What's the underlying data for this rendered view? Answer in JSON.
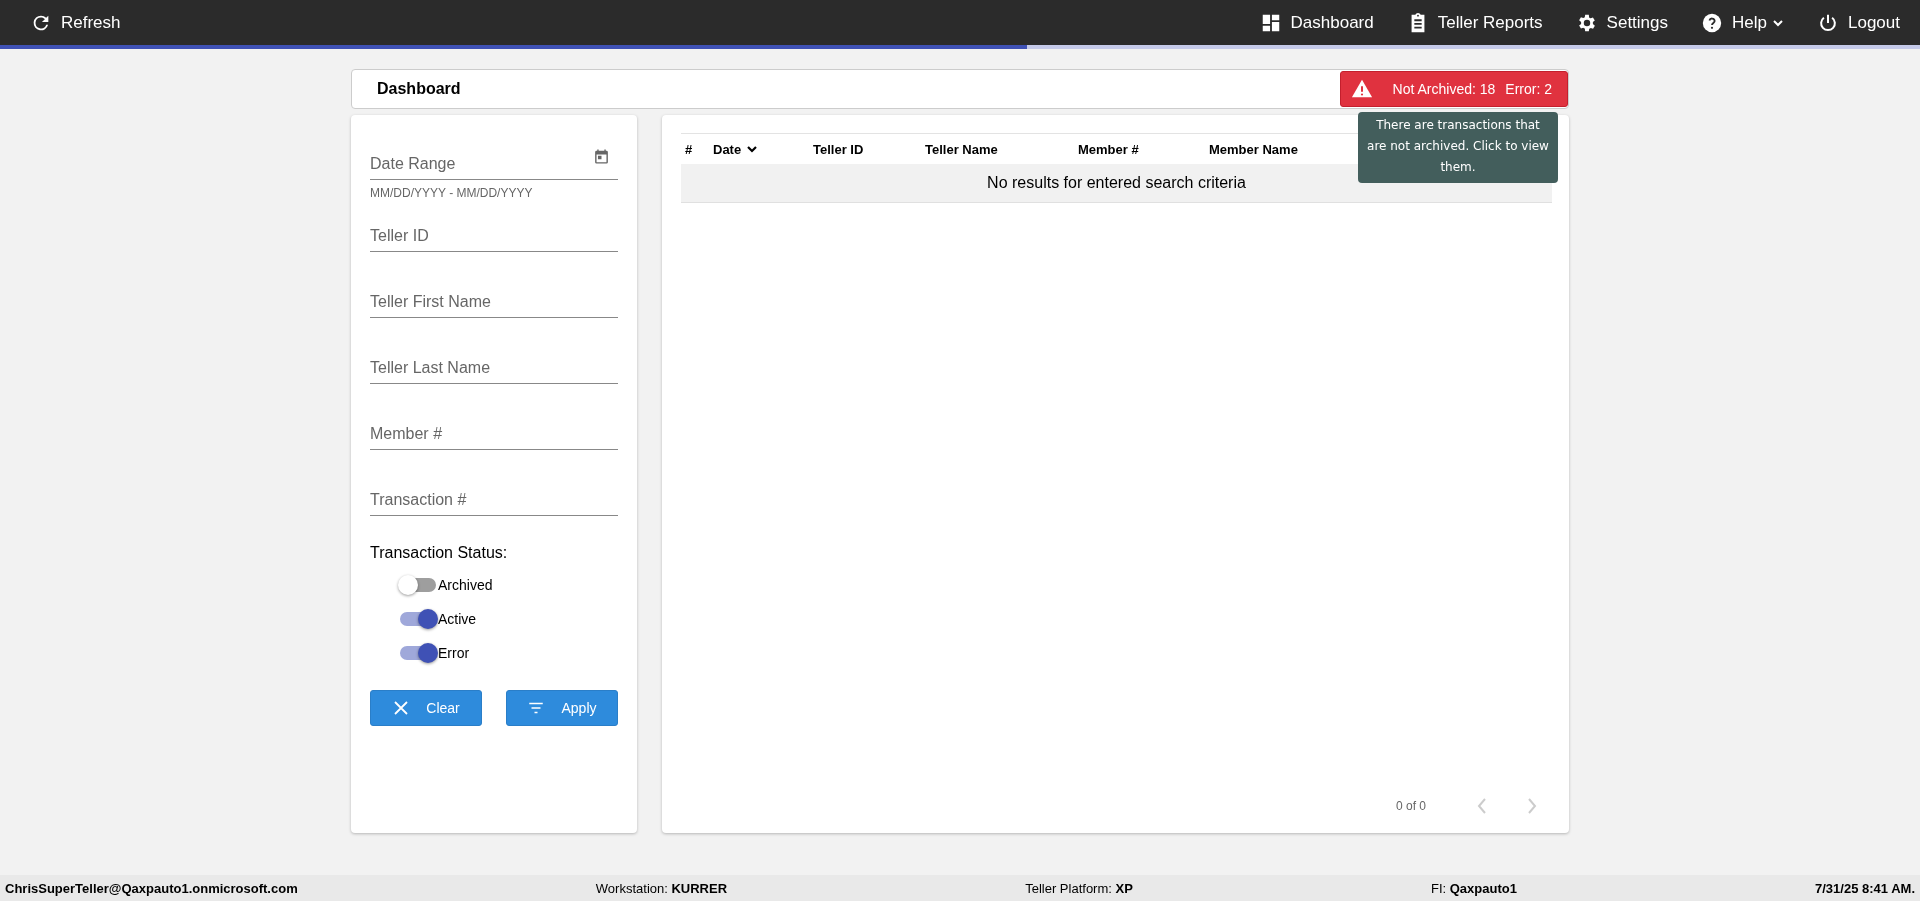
{
  "toolbar": {
    "refresh": "Refresh",
    "progress": {
      "level": 0.535
    }
  },
  "nav": [
    {
      "kind": "dashboard",
      "label": "Dashboard",
      "dropdown": false
    },
    {
      "kind": "reports",
      "label": "Teller Reports",
      "dropdown": false
    },
    {
      "kind": "settings",
      "label": "Settings",
      "dropdown": false
    },
    {
      "kind": "help",
      "label": "Help",
      "dropdown": true
    },
    {
      "kind": "logout",
      "label": "Logout",
      "dropdown": false
    }
  ],
  "page_title": "Dashboard",
  "alert": {
    "not_archived": "Not Archived: 18",
    "error": "Error: 2",
    "tooltip": "There are transactions that are not archived. Click to view them."
  },
  "filters": [
    {
      "kind": "date",
      "placeholder": "Date Range",
      "hint": "MM/DD/YYYY - MM/DD/YYYY"
    },
    {
      "kind": "text",
      "placeholder": "Teller ID"
    },
    {
      "kind": "text",
      "placeholder": "Teller First Name"
    },
    {
      "kind": "text",
      "placeholder": "Teller Last Name"
    },
    {
      "kind": "text",
      "placeholder": "Member #"
    },
    {
      "kind": "text",
      "placeholder": "Transaction #"
    }
  ],
  "status_label": "Transaction Status:",
  "toggles": [
    {
      "label": "Archived",
      "on": false
    },
    {
      "label": "Active",
      "on": true
    },
    {
      "label": "Error",
      "on": true
    }
  ],
  "buttons": [
    {
      "kind": "clear",
      "label": "Clear"
    },
    {
      "kind": "apply",
      "label": "Apply"
    }
  ],
  "table": {
    "columns": [
      {
        "label": "#",
        "sorted": false
      },
      {
        "label": "Date",
        "sorted": true
      },
      {
        "label": "Teller ID",
        "sorted": false
      },
      {
        "label": "Teller Name",
        "sorted": false
      },
      {
        "label": "Member #",
        "sorted": false
      },
      {
        "label": "Member Name",
        "sorted": false
      }
    ],
    "empty_message": "No results for entered search criteria",
    "pagination": {
      "range": "0 of 0",
      "prev_disabled": true,
      "next_disabled": true
    }
  },
  "status_bar": [
    {
      "value": "ChrisSuperTeller@Qaxpauto1.onmicrosoft.com"
    },
    {
      "label": "Workstation:",
      "value": "KURRER"
    },
    {
      "label": "Teller Platform:",
      "value": "XP"
    },
    {
      "label": "FI:",
      "value": "Qaxpauto1"
    },
    {
      "value": "7/31/25 8:41 AM."
    }
  ]
}
